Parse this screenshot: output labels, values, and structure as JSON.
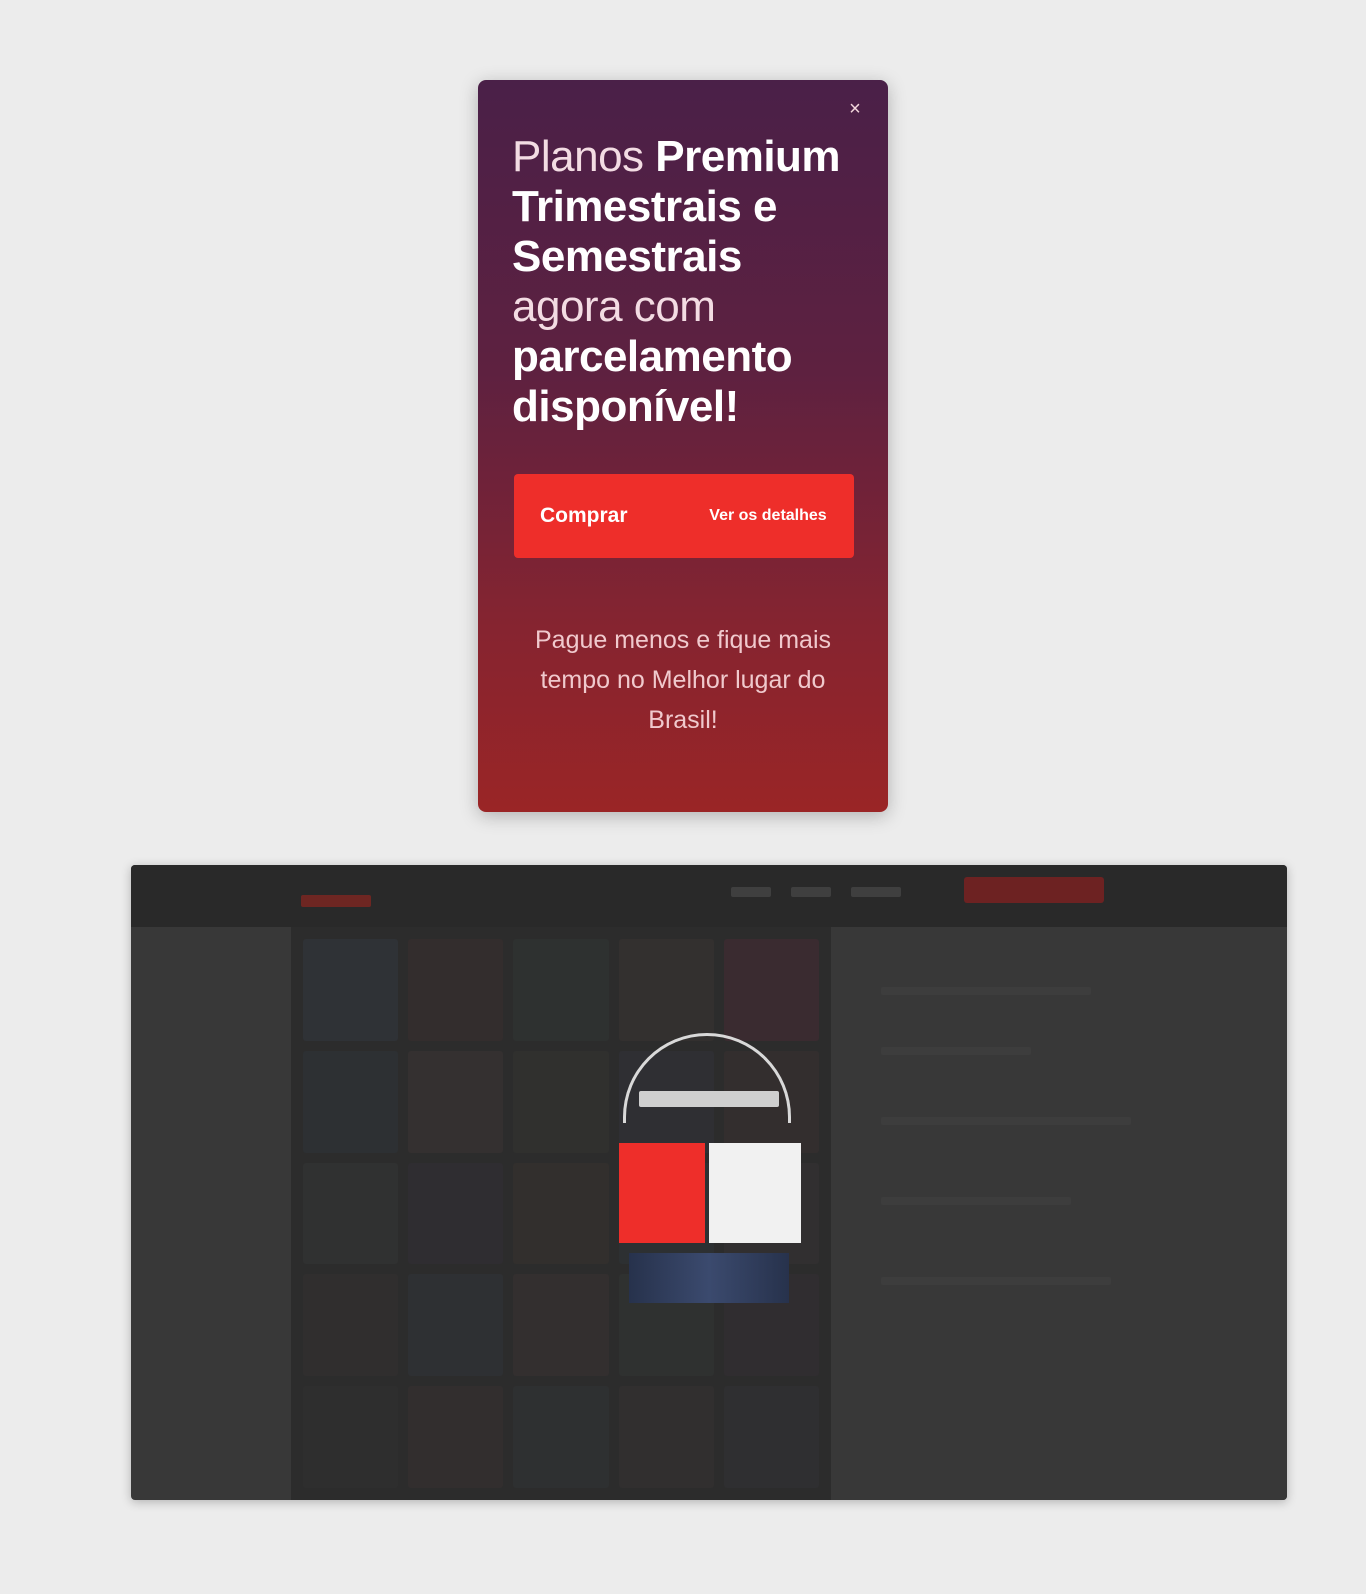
{
  "popup": {
    "close_label": "×",
    "headline_part1": "Planos ",
    "headline_part2": "Premium Trimestrais e Semestrais",
    "headline_part3": " agora com ",
    "headline_part4": "parcelamento disponível!",
    "cta_left": "Comprar",
    "cta_right": "Ver os detalhes",
    "benefits": "Pague menos e fique mais tempo no Melhor lugar do Brasil!"
  },
  "colors": {
    "popup_gradient_top": "#4a2048",
    "popup_gradient_bottom": "#9a2526",
    "cta_red": "#ee2e2a",
    "preview_bg": "#383838",
    "page_bg": "#ececec"
  },
  "icons": {
    "close": "close-icon"
  }
}
